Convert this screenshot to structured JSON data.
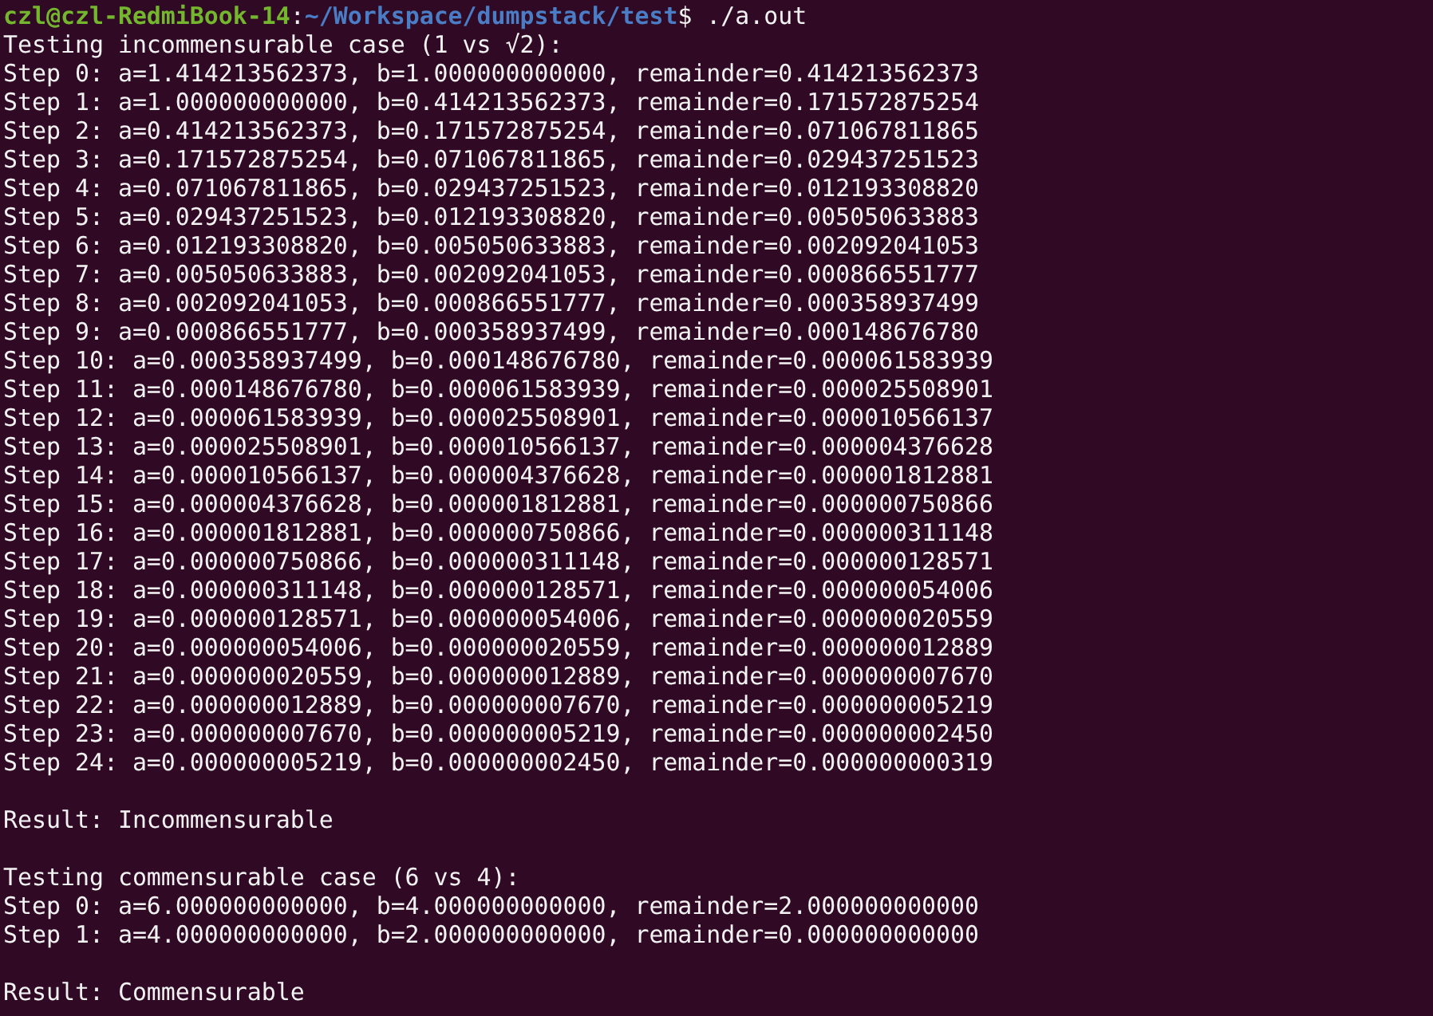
{
  "terminal": {
    "lines": [
      {
        "kind": "prompt",
        "user_host": "czl@czl-RedmiBook-14",
        "separator": ":",
        "path": "~/Workspace/dumpstack/test",
        "symbol": "$",
        "command": "./a.out"
      },
      {
        "kind": "output",
        "text": "Testing incommensurable case (1 vs √2):"
      },
      {
        "kind": "output",
        "text": "Step 0: a=1.414213562373, b=1.000000000000, remainder=0.414213562373"
      },
      {
        "kind": "output",
        "text": "Step 1: a=1.000000000000, b=0.414213562373, remainder=0.171572875254"
      },
      {
        "kind": "output",
        "text": "Step 2: a=0.414213562373, b=0.171572875254, remainder=0.071067811865"
      },
      {
        "kind": "output",
        "text": "Step 3: a=0.171572875254, b=0.071067811865, remainder=0.029437251523"
      },
      {
        "kind": "output",
        "text": "Step 4: a=0.071067811865, b=0.029437251523, remainder=0.012193308820"
      },
      {
        "kind": "output",
        "text": "Step 5: a=0.029437251523, b=0.012193308820, remainder=0.005050633883"
      },
      {
        "kind": "output",
        "text": "Step 6: a=0.012193308820, b=0.005050633883, remainder=0.002092041053"
      },
      {
        "kind": "output",
        "text": "Step 7: a=0.005050633883, b=0.002092041053, remainder=0.000866551777"
      },
      {
        "kind": "output",
        "text": "Step 8: a=0.002092041053, b=0.000866551777, remainder=0.000358937499"
      },
      {
        "kind": "output",
        "text": "Step 9: a=0.000866551777, b=0.000358937499, remainder=0.000148676780"
      },
      {
        "kind": "output",
        "text": "Step 10: a=0.000358937499, b=0.000148676780, remainder=0.000061583939"
      },
      {
        "kind": "output",
        "text": "Step 11: a=0.000148676780, b=0.000061583939, remainder=0.000025508901"
      },
      {
        "kind": "output",
        "text": "Step 12: a=0.000061583939, b=0.000025508901, remainder=0.000010566137"
      },
      {
        "kind": "output",
        "text": "Step 13: a=0.000025508901, b=0.000010566137, remainder=0.000004376628"
      },
      {
        "kind": "output",
        "text": "Step 14: a=0.000010566137, b=0.000004376628, remainder=0.000001812881"
      },
      {
        "kind": "output",
        "text": "Step 15: a=0.000004376628, b=0.000001812881, remainder=0.000000750866"
      },
      {
        "kind": "output",
        "text": "Step 16: a=0.000001812881, b=0.000000750866, remainder=0.000000311148"
      },
      {
        "kind": "output",
        "text": "Step 17: a=0.000000750866, b=0.000000311148, remainder=0.000000128571"
      },
      {
        "kind": "output",
        "text": "Step 18: a=0.000000311148, b=0.000000128571, remainder=0.000000054006"
      },
      {
        "kind": "output",
        "text": "Step 19: a=0.000000128571, b=0.000000054006, remainder=0.000000020559"
      },
      {
        "kind": "output",
        "text": "Step 20: a=0.000000054006, b=0.000000020559, remainder=0.000000012889"
      },
      {
        "kind": "output",
        "text": "Step 21: a=0.000000020559, b=0.000000012889, remainder=0.000000007670"
      },
      {
        "kind": "output",
        "text": "Step 22: a=0.000000012889, b=0.000000007670, remainder=0.000000005219"
      },
      {
        "kind": "output",
        "text": "Step 23: a=0.000000007670, b=0.000000005219, remainder=0.000000002450"
      },
      {
        "kind": "output",
        "text": "Step 24: a=0.000000005219, b=0.000000002450, remainder=0.000000000319"
      },
      {
        "kind": "blank"
      },
      {
        "kind": "output",
        "text": "Result: Incommensurable"
      },
      {
        "kind": "blank"
      },
      {
        "kind": "output",
        "text": "Testing commensurable case (6 vs 4):"
      },
      {
        "kind": "output",
        "text": "Step 0: a=6.000000000000, b=4.000000000000, remainder=2.000000000000"
      },
      {
        "kind": "output",
        "text": "Step 1: a=4.000000000000, b=2.000000000000, remainder=0.000000000000"
      },
      {
        "kind": "blank"
      },
      {
        "kind": "output",
        "text": "Result: Commensurable"
      }
    ]
  }
}
